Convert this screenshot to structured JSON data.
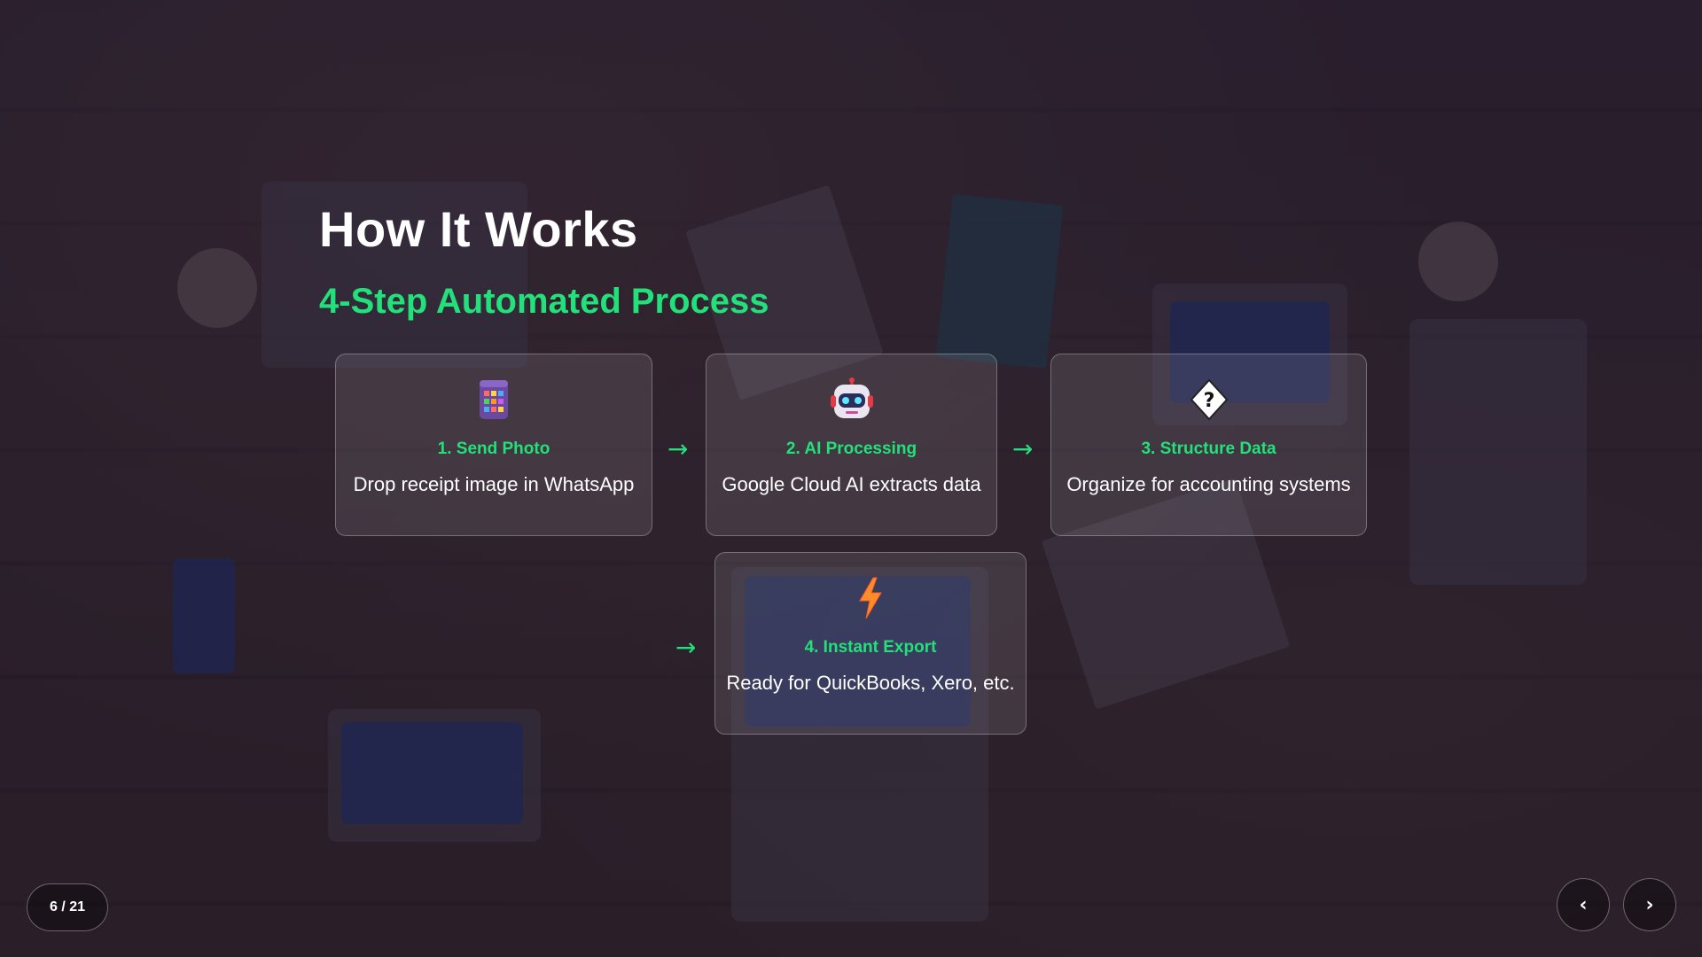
{
  "slide": {
    "title": "How It Works",
    "subtitle": "4-Step Automated Process"
  },
  "steps": [
    {
      "icon": "calendar-grid-icon",
      "title": "1. Send Photo",
      "description": "Drop receipt image in WhatsApp"
    },
    {
      "icon": "robot-icon",
      "title": "2. AI Processing",
      "description": "Google Cloud AI extracts data"
    },
    {
      "icon": "question-diamond-icon",
      "title": "3. Structure Data",
      "description": "Organize for accounting systems"
    },
    {
      "icon": "lightning-icon",
      "title": "4. Instant Export",
      "description": "Ready for QuickBooks, Xero, etc."
    }
  ],
  "arrow_glyph": "→",
  "navigation": {
    "counter": "6 / 21",
    "prev_label": "‹",
    "next_label": "›"
  },
  "colors": {
    "accent": "#22e07a",
    "text": "#ffffff"
  }
}
